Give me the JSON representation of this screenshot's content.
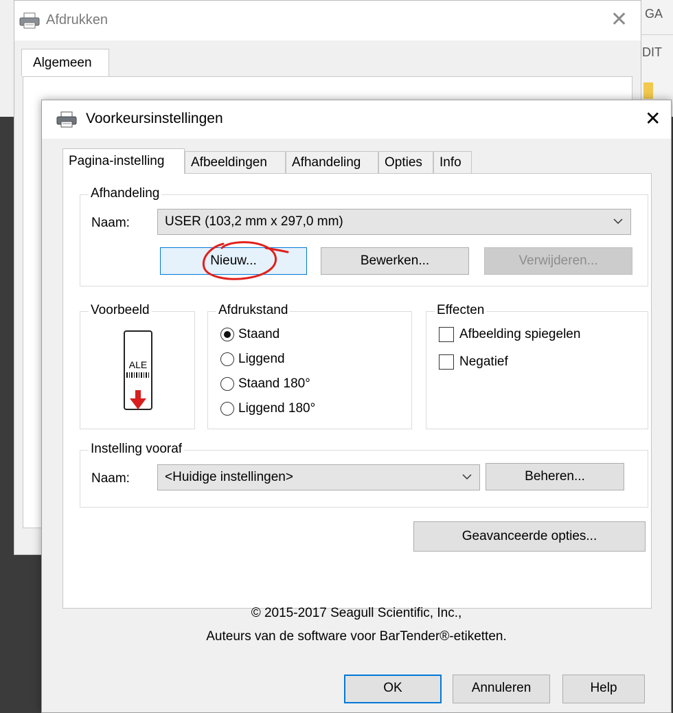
{
  "background_app": {
    "header_text": "GA",
    "subheader_text": "DIT"
  },
  "print_window": {
    "title": "Afdrukken",
    "tab_label": "Algemeen",
    "icons": {
      "printer": "printer-icon",
      "close": "close-icon"
    }
  },
  "dialog": {
    "title": "Voorkeursinstellingen",
    "tabs": [
      {
        "label": "Pagina-instelling",
        "active": true
      },
      {
        "label": "Afbeeldingen",
        "active": false
      },
      {
        "label": "Afhandeling",
        "active": false
      },
      {
        "label": "Opties",
        "active": false
      },
      {
        "label": "Info",
        "active": false
      }
    ],
    "afhandeling": {
      "legend": "Afhandeling",
      "name_label": "Naam:",
      "stock_value": "USER (103,2 mm x 297,0 mm)",
      "new_button": "Nieuw...",
      "edit_button": "Bewerken...",
      "delete_button": "Verwijderen...",
      "delete_enabled": false
    },
    "voorbeeld": {
      "legend": "Voorbeeld",
      "label_text": "ALE"
    },
    "afdrukstand": {
      "legend": "Afdrukstand",
      "options": [
        {
          "label": "Staand",
          "selected": true
        },
        {
          "label": "Liggend",
          "selected": false
        },
        {
          "label": "Staand 180°",
          "selected": false
        },
        {
          "label": "Liggend 180°",
          "selected": false
        }
      ]
    },
    "effecten": {
      "legend": "Effecten",
      "options": [
        {
          "label": "Afbeelding spiegelen",
          "checked": false
        },
        {
          "label": "Negatief",
          "checked": false
        }
      ]
    },
    "instelling_vooraf": {
      "legend": "Instelling vooraf",
      "name_label": "Naam:",
      "value": "<Huidige instellingen>",
      "manage_button": "Beheren..."
    },
    "advanced_button": "Geavanceerde opties...",
    "copyright_line1": "© 2015-2017 Seagull Scientific, Inc.,",
    "copyright_line2": "Auteurs van de software voor BarTender®-etiketten.",
    "ok_button": "OK",
    "cancel_button": "Annuleren",
    "help_button": "Help"
  },
  "colors": {
    "accent": "#0078d7",
    "annotation": "#e0201c",
    "preview_arrow": "#d81e1e"
  }
}
